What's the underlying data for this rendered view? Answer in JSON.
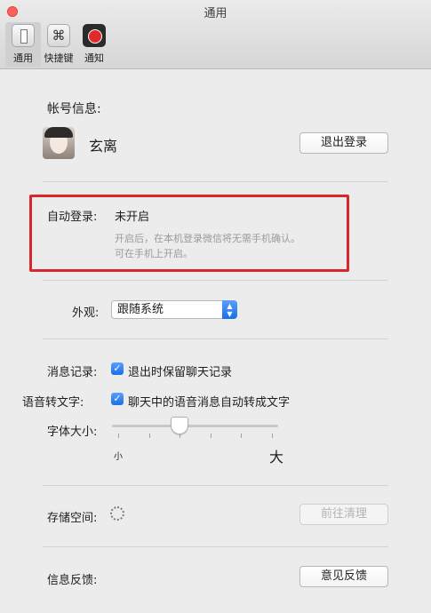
{
  "window": {
    "title": "通用"
  },
  "toolbar": {
    "items": [
      {
        "label": "通用",
        "icon": "general-switch-icon"
      },
      {
        "label": "快捷键",
        "icon": "command-key-icon",
        "glyph": "⌘"
      },
      {
        "label": "通知",
        "icon": "notification-record-icon"
      }
    ]
  },
  "account": {
    "label": "帐号信息:",
    "username": "玄离",
    "logout_button": "退出登录"
  },
  "auto_login": {
    "label": "自动登录:",
    "value": "未开启",
    "hint_line1": "开启后，在本机登录微信将无需手机确认。",
    "hint_line2": "可在手机上开启。"
  },
  "appearance": {
    "label": "外观:",
    "selected": "跟随系统"
  },
  "chat_history": {
    "label": "消息记录:",
    "checkbox_label": "退出时保留聊天记录",
    "checked": true
  },
  "voice_to_text": {
    "label": "语音转文字:",
    "checkbox_label": "聊天中的语音消息自动转成文字",
    "checked": true
  },
  "font_size": {
    "label": "字体大小:",
    "min_label": "小",
    "max_label": "大",
    "level": 0.4
  },
  "storage": {
    "label": "存储空间:",
    "button": "前往清理"
  },
  "feedback": {
    "label": "信息反馈:",
    "button": "意见反馈"
  },
  "colors": {
    "accent": "#1c6ee8",
    "highlight": "#d9262c"
  }
}
